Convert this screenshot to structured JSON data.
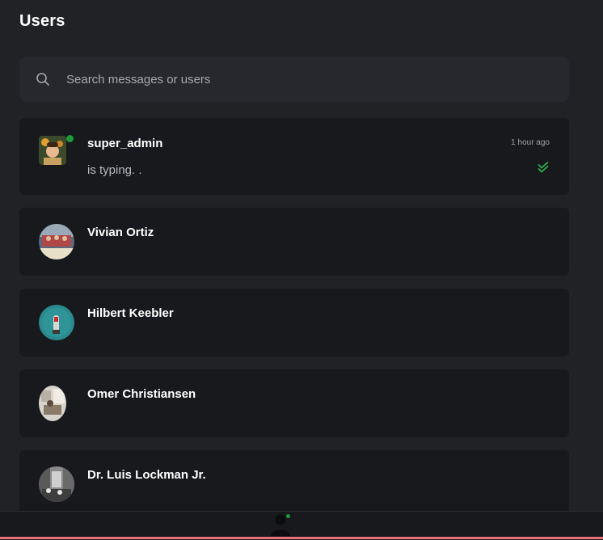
{
  "header": {
    "title": "Users"
  },
  "search": {
    "placeholder": "Search messages or users",
    "icon": "search-icon"
  },
  "colors": {
    "background": "#202226",
    "card": "#17191c",
    "online": "#1d9b3b",
    "read_check": "#2cae4f",
    "accent_bar": "#e8707a"
  },
  "users": [
    {
      "name": "super_admin",
      "preview": "is typing. .",
      "time": "1 hour ago",
      "online": true,
      "read_status": "double-check-icon"
    },
    {
      "name": "Vivian Ortiz"
    },
    {
      "name": "Hilbert Keebler"
    },
    {
      "name": "Omer Christiansen"
    },
    {
      "name": "Dr. Luis Lockman Jr."
    }
  ],
  "bottom_nav": {
    "profile_icon": "user-profile-icon",
    "online": true
  }
}
